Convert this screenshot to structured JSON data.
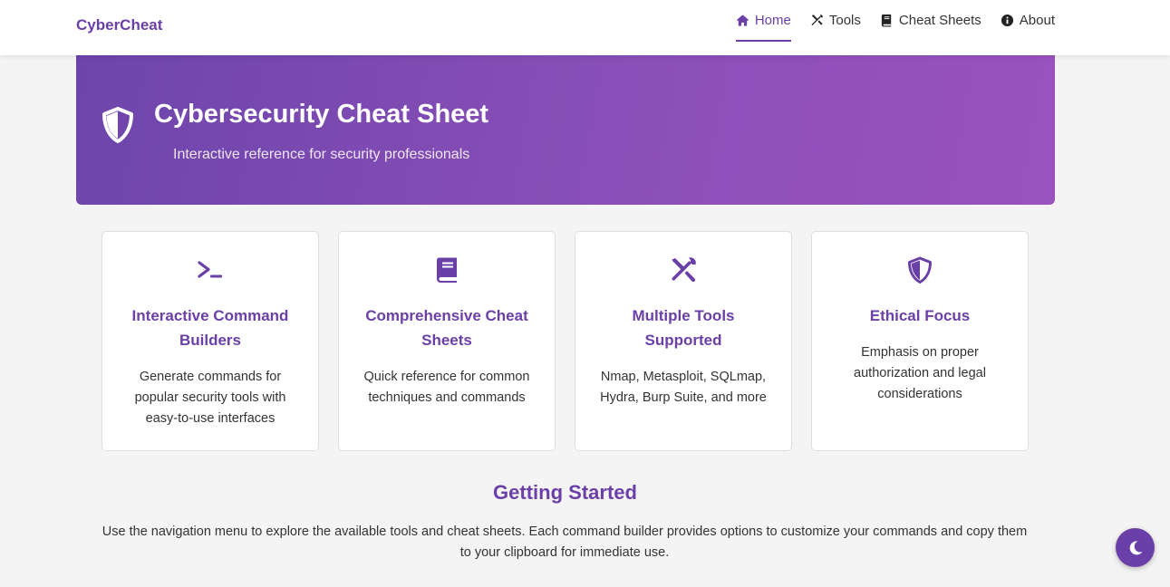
{
  "brand": "CyberCheat",
  "nav": [
    {
      "label": "Home",
      "icon": "home-icon",
      "active": true
    },
    {
      "label": "Tools",
      "icon": "tools-icon",
      "active": false
    },
    {
      "label": "Cheat Sheets",
      "icon": "book-icon",
      "active": false
    },
    {
      "label": "About",
      "icon": "info-icon",
      "active": false
    }
  ],
  "hero": {
    "icon": "shield-icon",
    "title": "Cybersecurity Cheat Sheet",
    "subtitle": "Interactive reference for security professionals"
  },
  "features": [
    {
      "icon": "terminal-icon",
      "title": "Interactive Command Builders",
      "desc": "Generate commands for popular security tools with easy-to-use interfaces"
    },
    {
      "icon": "book-icon",
      "title": "Comprehensive Cheat Sheets",
      "desc": "Quick reference for common techniques and commands"
    },
    {
      "icon": "tools-icon",
      "title": "Multiple Tools Supported",
      "desc": "Nmap, Metasploit, SQLmap, Hydra, Burp Suite, and more"
    },
    {
      "icon": "shield-icon",
      "title": "Ethical Focus",
      "desc": "Emphasis on proper authorization and legal considerations"
    }
  ],
  "getting_started": {
    "title": "Getting Started",
    "text": "Use the navigation menu to explore the available tools and cheat sheets. Each command builder provides options to customize your commands and copy them to your clipboard for immediate use."
  },
  "theme_toggle": {
    "icon": "moon-icon"
  },
  "colors": {
    "accent": "#6b3fa8",
    "hero_start": "#6d45ab",
    "hero_end": "#9a52be",
    "background": "#f4f4f4"
  }
}
